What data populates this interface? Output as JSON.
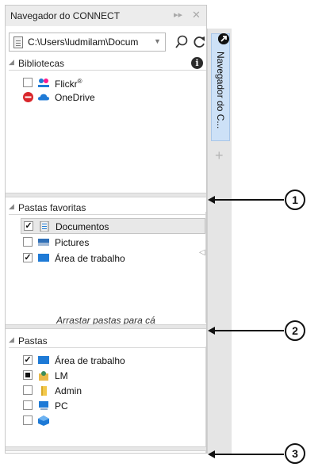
{
  "panel": {
    "title": "Navegador do CONNECT",
    "title_icons": [
      "pin-arrows-icon",
      "close-icon"
    ],
    "path": "C:\\Users\\ludmilam\\Docum",
    "toolbar_icons": [
      "search-icon",
      "refresh-icon"
    ]
  },
  "libraries": {
    "title": "Bibliotecas",
    "items": [
      {
        "label": "Flickr",
        "mark": "®",
        "checked": false,
        "icon": "flickr-icon"
      },
      {
        "label": "OneDrive",
        "checked": null,
        "icon": "onedrive-icon",
        "status_icon": "blocked-icon"
      }
    ]
  },
  "favorites": {
    "title": "Pastas favoritas",
    "items": [
      {
        "label": "Documentos",
        "checked": true,
        "selected": true,
        "icon": "documents-icon"
      },
      {
        "label": "Pictures",
        "checked": false,
        "icon": "pictures-icon"
      },
      {
        "label": "Área de trabalho",
        "checked": true,
        "icon": "desktop-icon"
      }
    ],
    "hint": "Arrastar pastas para cá"
  },
  "folders": {
    "title": "Pastas",
    "items": [
      {
        "label": "Área de trabalho",
        "checked": true,
        "icon": "desktop-icon"
      },
      {
        "label": "LM",
        "checked": "partial",
        "icon": "user-folder-icon"
      },
      {
        "label": "Admin",
        "checked": false,
        "icon": "folder-icon"
      },
      {
        "label": "PC",
        "checked": false,
        "icon": "computer-icon"
      },
      {
        "label": "",
        "checked": false,
        "icon": "network-icon"
      }
    ]
  },
  "side_tab": {
    "label": "Navegador do C...",
    "add_icon": "plus-icon"
  },
  "callouts": [
    "1",
    "2",
    "3"
  ],
  "colors": {
    "accent_blue": "#1e7ad6",
    "tab_active": "#cde1f7",
    "blocked_red": "#d9262b"
  }
}
